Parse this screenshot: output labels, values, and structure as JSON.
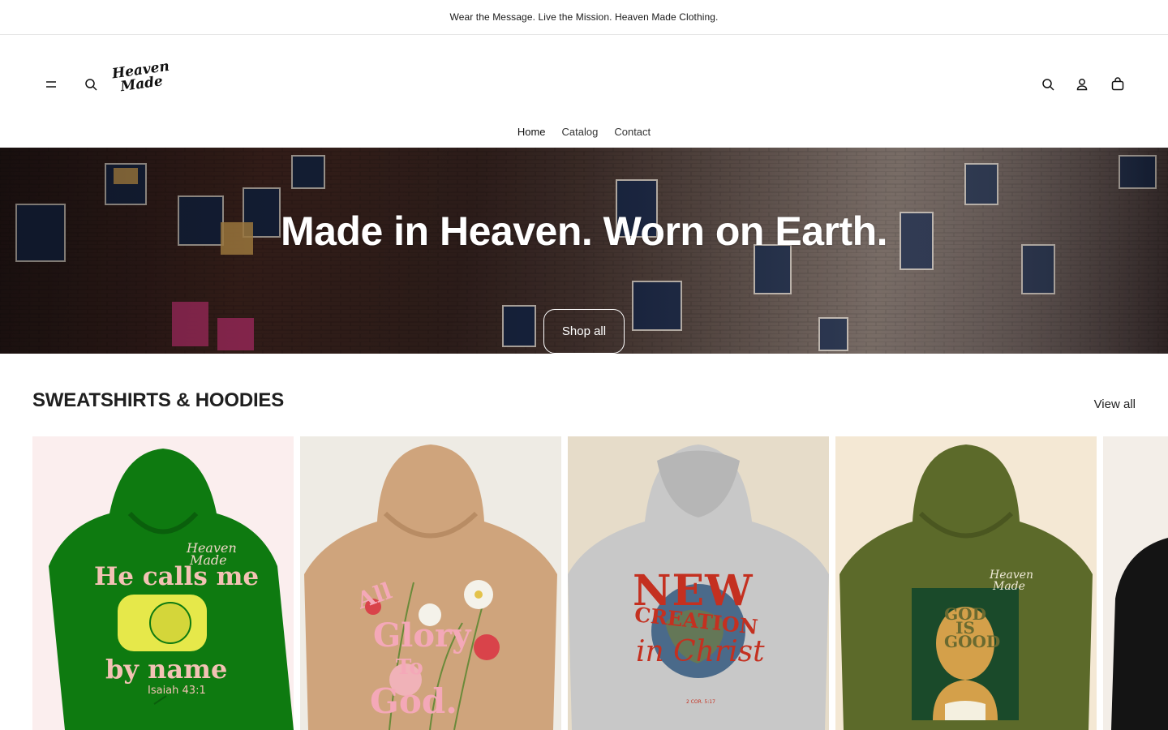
{
  "announcement": {
    "text": "Wear the Message. Live the Mission. Heaven Made Clothing."
  },
  "header": {
    "logo_line1": "Heaven",
    "logo_line2": "Made",
    "nav": [
      {
        "label": "Home",
        "active": true
      },
      {
        "label": "Catalog",
        "active": false
      },
      {
        "label": "Contact",
        "active": false
      }
    ]
  },
  "hero": {
    "title": "Made in Heaven. Worn on Earth.",
    "button_label": "Shop all"
  },
  "collection": {
    "title": "SWEATSHIRTS & HOODIES",
    "view_all": "View all",
    "products": [
      {
        "bg": "#fbeeee",
        "garment": "#0e7a10",
        "print_top": "He calls me",
        "print_bottom": "by name",
        "ref": "Isaiah 43:1",
        "brand1": "Heaven",
        "brand2": "Made"
      },
      {
        "bg": "#eeebe4",
        "garment": "#cfa47c",
        "print_top": "All",
        "print_mid": "Glory",
        "print_mid2": "To",
        "print_bottom": "God."
      },
      {
        "bg": "#e6dcc9",
        "garment": "#c8c8c8",
        "print_top": "NEW",
        "print_mid": "CREATION",
        "print_bottom": "in Christ",
        "ref": "2 COR. 5:17"
      },
      {
        "bg": "#f4e8d4",
        "garment": "#5c6a2a",
        "print_top": "GOD",
        "print_mid": "IS",
        "print_bottom": "GOOD",
        "brand1": "Heaven",
        "brand2": "Made"
      },
      {
        "bg": "#f3eee8",
        "garment": "#141414"
      }
    ]
  },
  "colors": {
    "announcement_border": "#e6e6e6",
    "hero_text": "#ffffff",
    "body_text": "#121212"
  }
}
